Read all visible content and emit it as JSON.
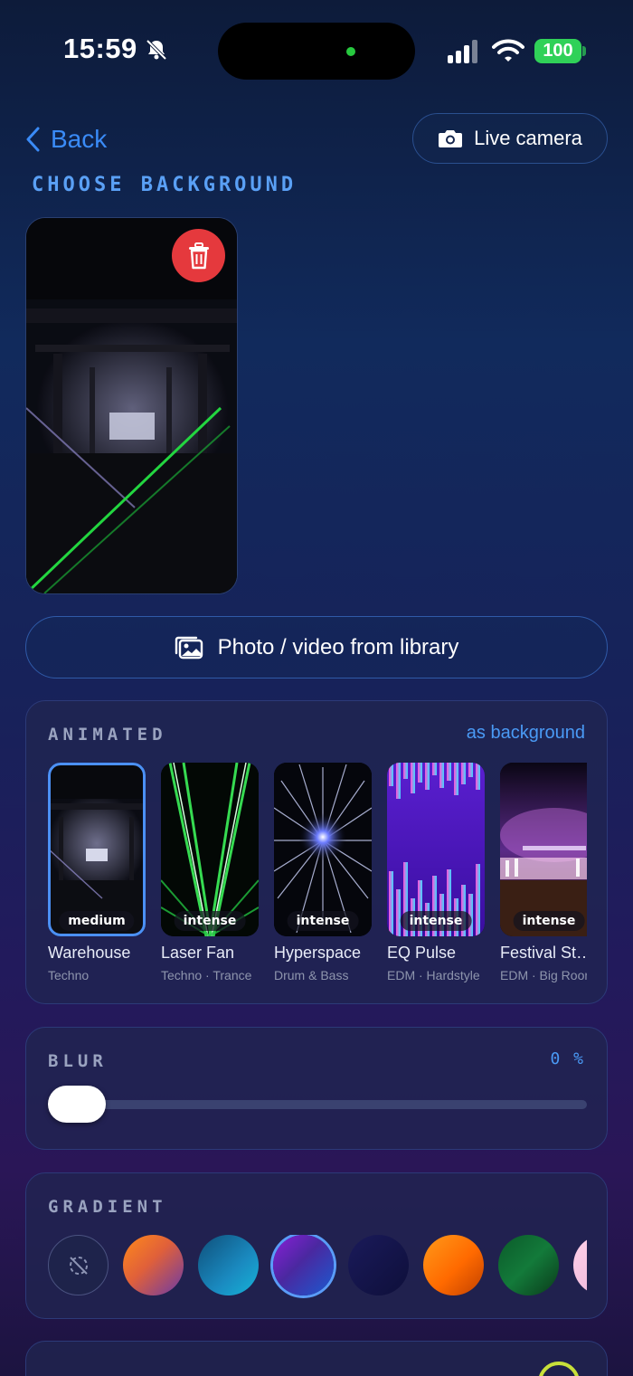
{
  "status_bar": {
    "time": "15:59",
    "battery": "100"
  },
  "nav": {
    "back_label": "Back",
    "live_camera_label": "Live camera"
  },
  "title": "CHOOSE BACKGROUND",
  "library_button_label": "Photo / video from library",
  "animated": {
    "label": "ANIMATED",
    "as_background": "as background",
    "items": [
      {
        "name": "Warehouse",
        "genre": "Techno",
        "intensity": "medium",
        "selected": true
      },
      {
        "name": "Laser Fan",
        "genre": "Techno · Trance",
        "intensity": "intense"
      },
      {
        "name": "Hyperspace",
        "genre": "Drum & Bass",
        "intensity": "intense"
      },
      {
        "name": "EQ Pulse",
        "genre": "EDM · Hardstyle",
        "intensity": "intense"
      },
      {
        "name": "Festival St…",
        "genre": "EDM · Big Room",
        "intensity": "intense"
      }
    ]
  },
  "blur": {
    "label": "BLUR",
    "value": "0 %",
    "level": 0
  },
  "gradient": {
    "label": "GRADIENT",
    "swatches": [
      "none",
      "orange-purple",
      "teal-blue",
      "purple-blue",
      "deep-navy",
      "orange",
      "green",
      "pink"
    ],
    "selected_index": 3
  },
  "colors": {
    "accent": "#3a8bf7",
    "delete": "#e5393d",
    "battery": "#30d158"
  }
}
